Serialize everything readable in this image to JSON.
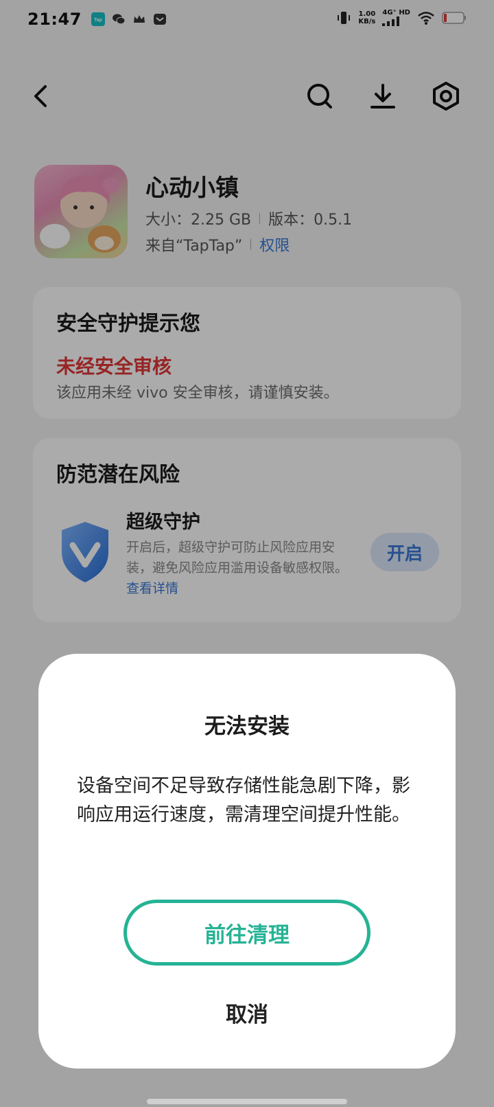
{
  "status_bar": {
    "time": "21:47",
    "left_icons": [
      "taptap-icon",
      "wechat-icon",
      "crown-icon",
      "mail-icon"
    ],
    "net_speed_value": "1.00",
    "net_speed_unit": "KB/s",
    "network_label": "4G⁺ HD",
    "right_icons": [
      "vibrate-icon",
      "signal-icon",
      "wifi-icon",
      "battery-icon"
    ]
  },
  "toolbar": {
    "icons": [
      "back-icon",
      "search-icon",
      "download-icon",
      "settings-icon"
    ]
  },
  "app": {
    "name": "心动小镇",
    "size_label": "大小：2.25 GB",
    "version_label": "版本：0.5.1",
    "source_label": "来自“TapTap”",
    "permission_link": "权限"
  },
  "security_card": {
    "title": "安全守护提示您",
    "warning_title": "未经安全审核",
    "warning_desc": "该应用未经 vivo 安全审核，请谨慎安装。"
  },
  "risk_card": {
    "title": "防范潜在风险",
    "protection_title": "超级守护",
    "protection_desc": "开启后，超级守护可防止风险应用安装，避免风险应用滥用设备敏感权限。",
    "details_link": "查看详情",
    "open_button": "开启"
  },
  "dialog": {
    "title": "无法安装",
    "message": "设备空间不足导致存储性能急剧下降，影响应用运行速度，需清理空间提升性能。",
    "primary_button": "前往清理",
    "cancel_button": "取消"
  },
  "colors": {
    "accent_green": "#25b395",
    "link_blue": "#3a78d6",
    "warning_red": "#e23636"
  }
}
